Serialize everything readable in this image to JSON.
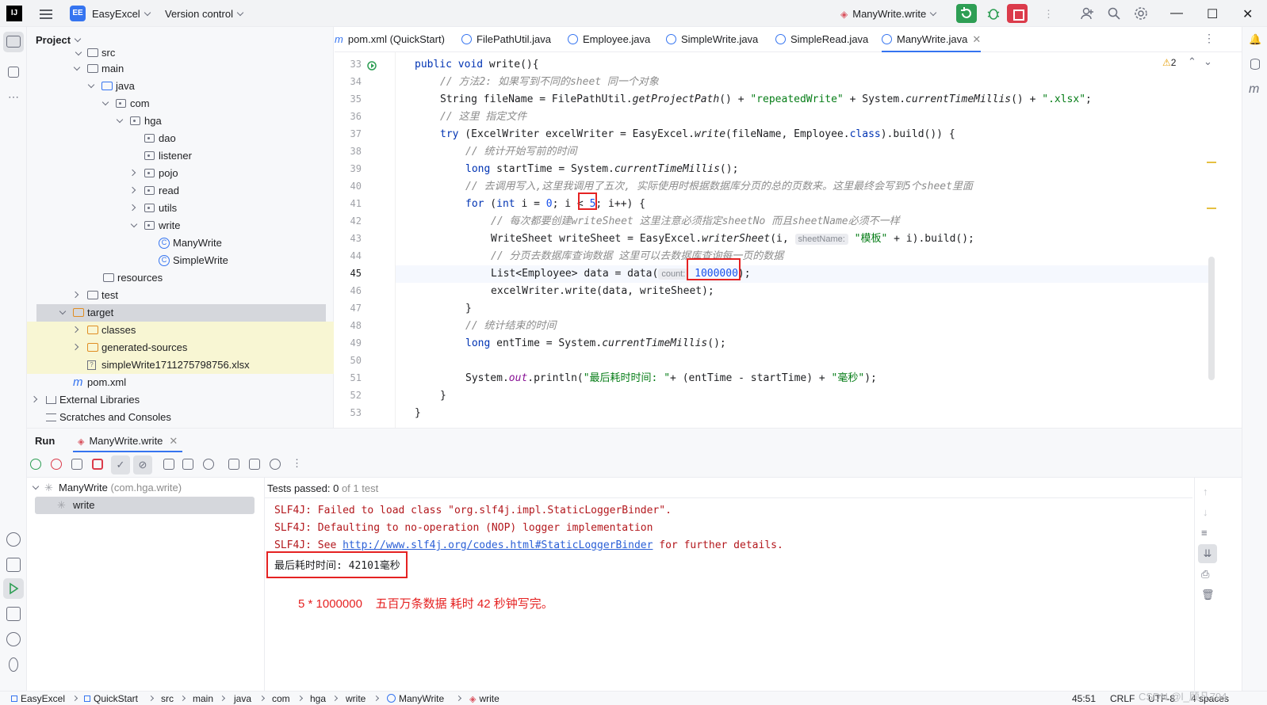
{
  "titlebar": {
    "logo": "IJ",
    "project_badge": "EE",
    "project_name": "EasyExcel",
    "vcs": "Version control",
    "run_config": "ManyWrite.write"
  },
  "project_panel": {
    "title": "Project",
    "items": [
      {
        "label": "src"
      },
      {
        "label": "main"
      },
      {
        "label": "java"
      },
      {
        "label": "com"
      },
      {
        "label": "hga"
      },
      {
        "label": "dao"
      },
      {
        "label": "listener"
      },
      {
        "label": "pojo"
      },
      {
        "label": "read"
      },
      {
        "label": "utils"
      },
      {
        "label": "write"
      },
      {
        "label": "ManyWrite"
      },
      {
        "label": "SimpleWrite"
      },
      {
        "label": "resources"
      },
      {
        "label": "test"
      },
      {
        "label": "target"
      },
      {
        "label": "classes"
      },
      {
        "label": "generated-sources"
      },
      {
        "label": "simpleWrite1711275798756.xlsx"
      },
      {
        "label": "pom.xml"
      },
      {
        "label": "External Libraries"
      },
      {
        "label": "Scratches and Consoles"
      }
    ]
  },
  "editor": {
    "tabs": [
      {
        "label": "pom.xml (QuickStart)"
      },
      {
        "label": "FilePathUtil.java"
      },
      {
        "label": "Employee.java"
      },
      {
        "label": "SimpleWrite.java"
      },
      {
        "label": "SimpleRead.java"
      },
      {
        "label": "ManyWrite.java"
      }
    ],
    "warnings": "2",
    "line_numbers": [
      "33",
      "34",
      "35",
      "36",
      "37",
      "38",
      "39",
      "40",
      "41",
      "42",
      "43",
      "44",
      "45",
      "46",
      "47",
      "48",
      "49",
      "50",
      "51",
      "52",
      "53"
    ],
    "code": {
      "l33_kw1": "public",
      "l33_kw2": "void",
      "l33_rest": " write(){",
      "l34": "// 方法2: 如果写到不同的sheet 同一个对象",
      "l35_a": "String fileName = FilePathUtil.",
      "l35_m": "getProjectPath",
      "l35_b": "() + ",
      "l35_s1": "\"repeatedWrite\"",
      "l35_c": " + System.",
      "l35_m2": "currentTimeMillis",
      "l35_d": "() + ",
      "l35_s2": "\".xlsx\"",
      "l35_e": ";",
      "l36": "// 这里 指定文件",
      "l37_kw": "try",
      "l37_a": " (ExcelWriter excelWriter = EasyExcel.",
      "l37_m": "write",
      "l37_b": "(fileName, Employee.",
      "l37_kw2": "class",
      "l37_c": ").build()) {",
      "l38": "// 统计开始写前的时间",
      "l39_kw": "long",
      "l39_a": " startTime = System.",
      "l39_m": "currentTimeMillis",
      "l39_b": "();",
      "l40": "// 去调用写入,这里我调用了五次, 实际使用时根据数据库分页的总的页数来。这里最终会写到5个sheet里面",
      "l41_kw": "for",
      "l41_a": " (",
      "l41_kw2": "int",
      "l41_b": " i = ",
      "l41_n0": "0",
      "l41_c": "; i < ",
      "l41_n5": "5",
      "l41_d": "; i++) {",
      "l42": "// 每次都要创建writeSheet 这里注意必须指定sheetNo 而且sheetName必须不一样",
      "l43_a": "WriteSheet writeSheet = EasyExcel.",
      "l43_m": "writerSheet",
      "l43_b": "(i, ",
      "l43_hint": "sheetName:",
      "l43_s": "\"模板\"",
      "l43_c": " + i).build();",
      "l44": "// 分页去数据库查询数据 这里可以去数据库查询每一页的数据",
      "l45_a": "List<Employee> data = data(",
      "l45_hint": "count:",
      "l45_n": "1000000",
      "l45_b": ");",
      "l46": "excelWriter.write(data, writeSheet);",
      "l47": "}",
      "l48": "// 统计结束的时间",
      "l49_kw": "long",
      "l49_a": " entTime = System.",
      "l49_m": "currentTimeMillis",
      "l49_b": "();",
      "l51_a": "System.",
      "l51_f": "out",
      "l51_b": ".println(",
      "l51_s1": "\"最后耗时时间: \"",
      "l51_c": "+ (entTime - startTime) + ",
      "l51_s2": "\"毫秒\"",
      "l51_d": ");",
      "l52": "}",
      "l53": "}"
    }
  },
  "run_panel": {
    "tab_run": "Run",
    "tab_config": "ManyWrite.write",
    "tree_root": "ManyWrite",
    "tree_root_pkg": "(com.hga.write)",
    "tree_child": "write",
    "tests_status_prefix": "Tests passed: ",
    "tests_status_count": "0",
    "tests_status_suffix": " of 1 test",
    "console": {
      "line1": "SLF4J: Failed to load class \"org.slf4j.impl.StaticLoggerBinder\".",
      "line2": "SLF4J: Defaulting to no-operation (NOP) logger implementation",
      "line3_a": "SLF4J: See ",
      "line3_link": "http://www.slf4j.org/codes.html#StaticLoggerBinder",
      "line3_b": " for further details.",
      "line4": "最后耗时时间: 42101毫秒",
      "annotation": "5 * 1000000    五百万条数据 耗时 42 秒钟写完。"
    }
  },
  "statusbar": {
    "crumbs": [
      "EasyExcel",
      "QuickStart",
      "src",
      "main",
      "java",
      "com",
      "hga",
      "write",
      "ManyWrite",
      "write"
    ],
    "position": "45:51",
    "line_sep": "CRLF",
    "encoding": "UTF-8",
    "indent": "4 spaces",
    "watermark": "CSDN @l_顾凡794"
  },
  "colors": {
    "accent": "#3574f0",
    "run_green": "#2e9e54",
    "stop_red": "#db3b4b",
    "annotation_red": "#e52222"
  }
}
